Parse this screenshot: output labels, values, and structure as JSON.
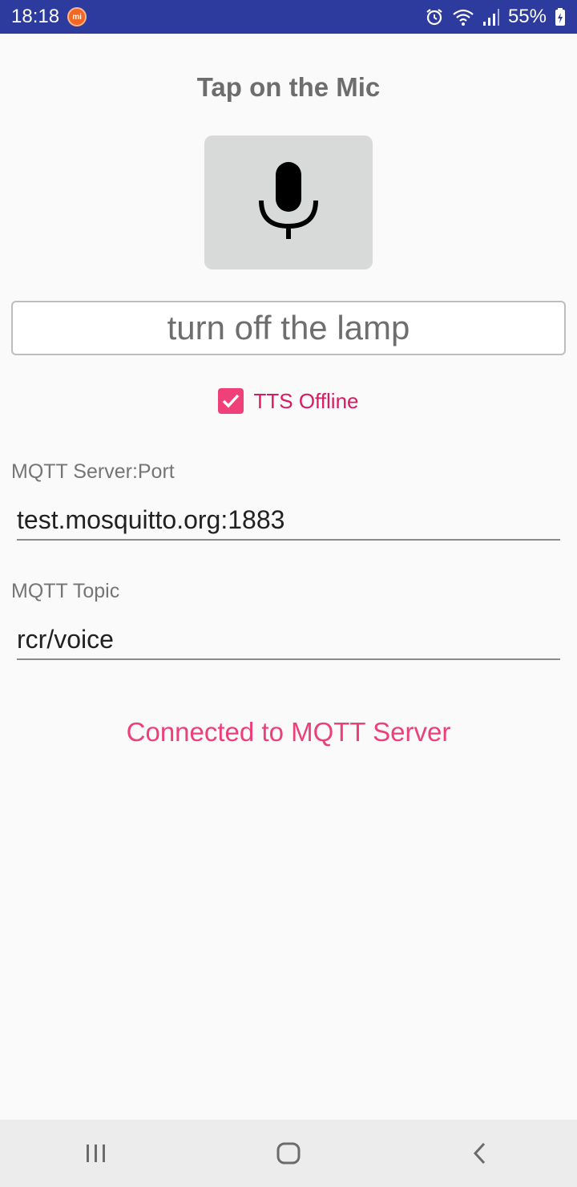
{
  "status_bar": {
    "time": "18:18",
    "mi_badge": "mi",
    "battery": "55%",
    "icons": [
      "alarm-icon",
      "wifi-icon",
      "signal-icon",
      "battery-icon"
    ]
  },
  "app": {
    "title": "Tap on the Mic",
    "mic_icon": "microphone-icon",
    "recognized_text": "turn off the lamp",
    "tts_checkbox": {
      "label": "TTS Offline",
      "checked": true
    },
    "server_label": "MQTT Server:Port",
    "server_value": "test.mosquitto.org:1883",
    "topic_label": "MQTT Topic",
    "topic_value": "rcr/voice",
    "connection_status": "Connected to MQTT Server"
  },
  "nav_bar": {
    "icons": [
      "recent-apps-icon",
      "home-icon",
      "back-icon"
    ]
  },
  "colors": {
    "status_bar": "#2d3b9e",
    "accent": "#ec407a",
    "checkbox": "#ef407a",
    "mic_button": "#d8d9d9"
  }
}
